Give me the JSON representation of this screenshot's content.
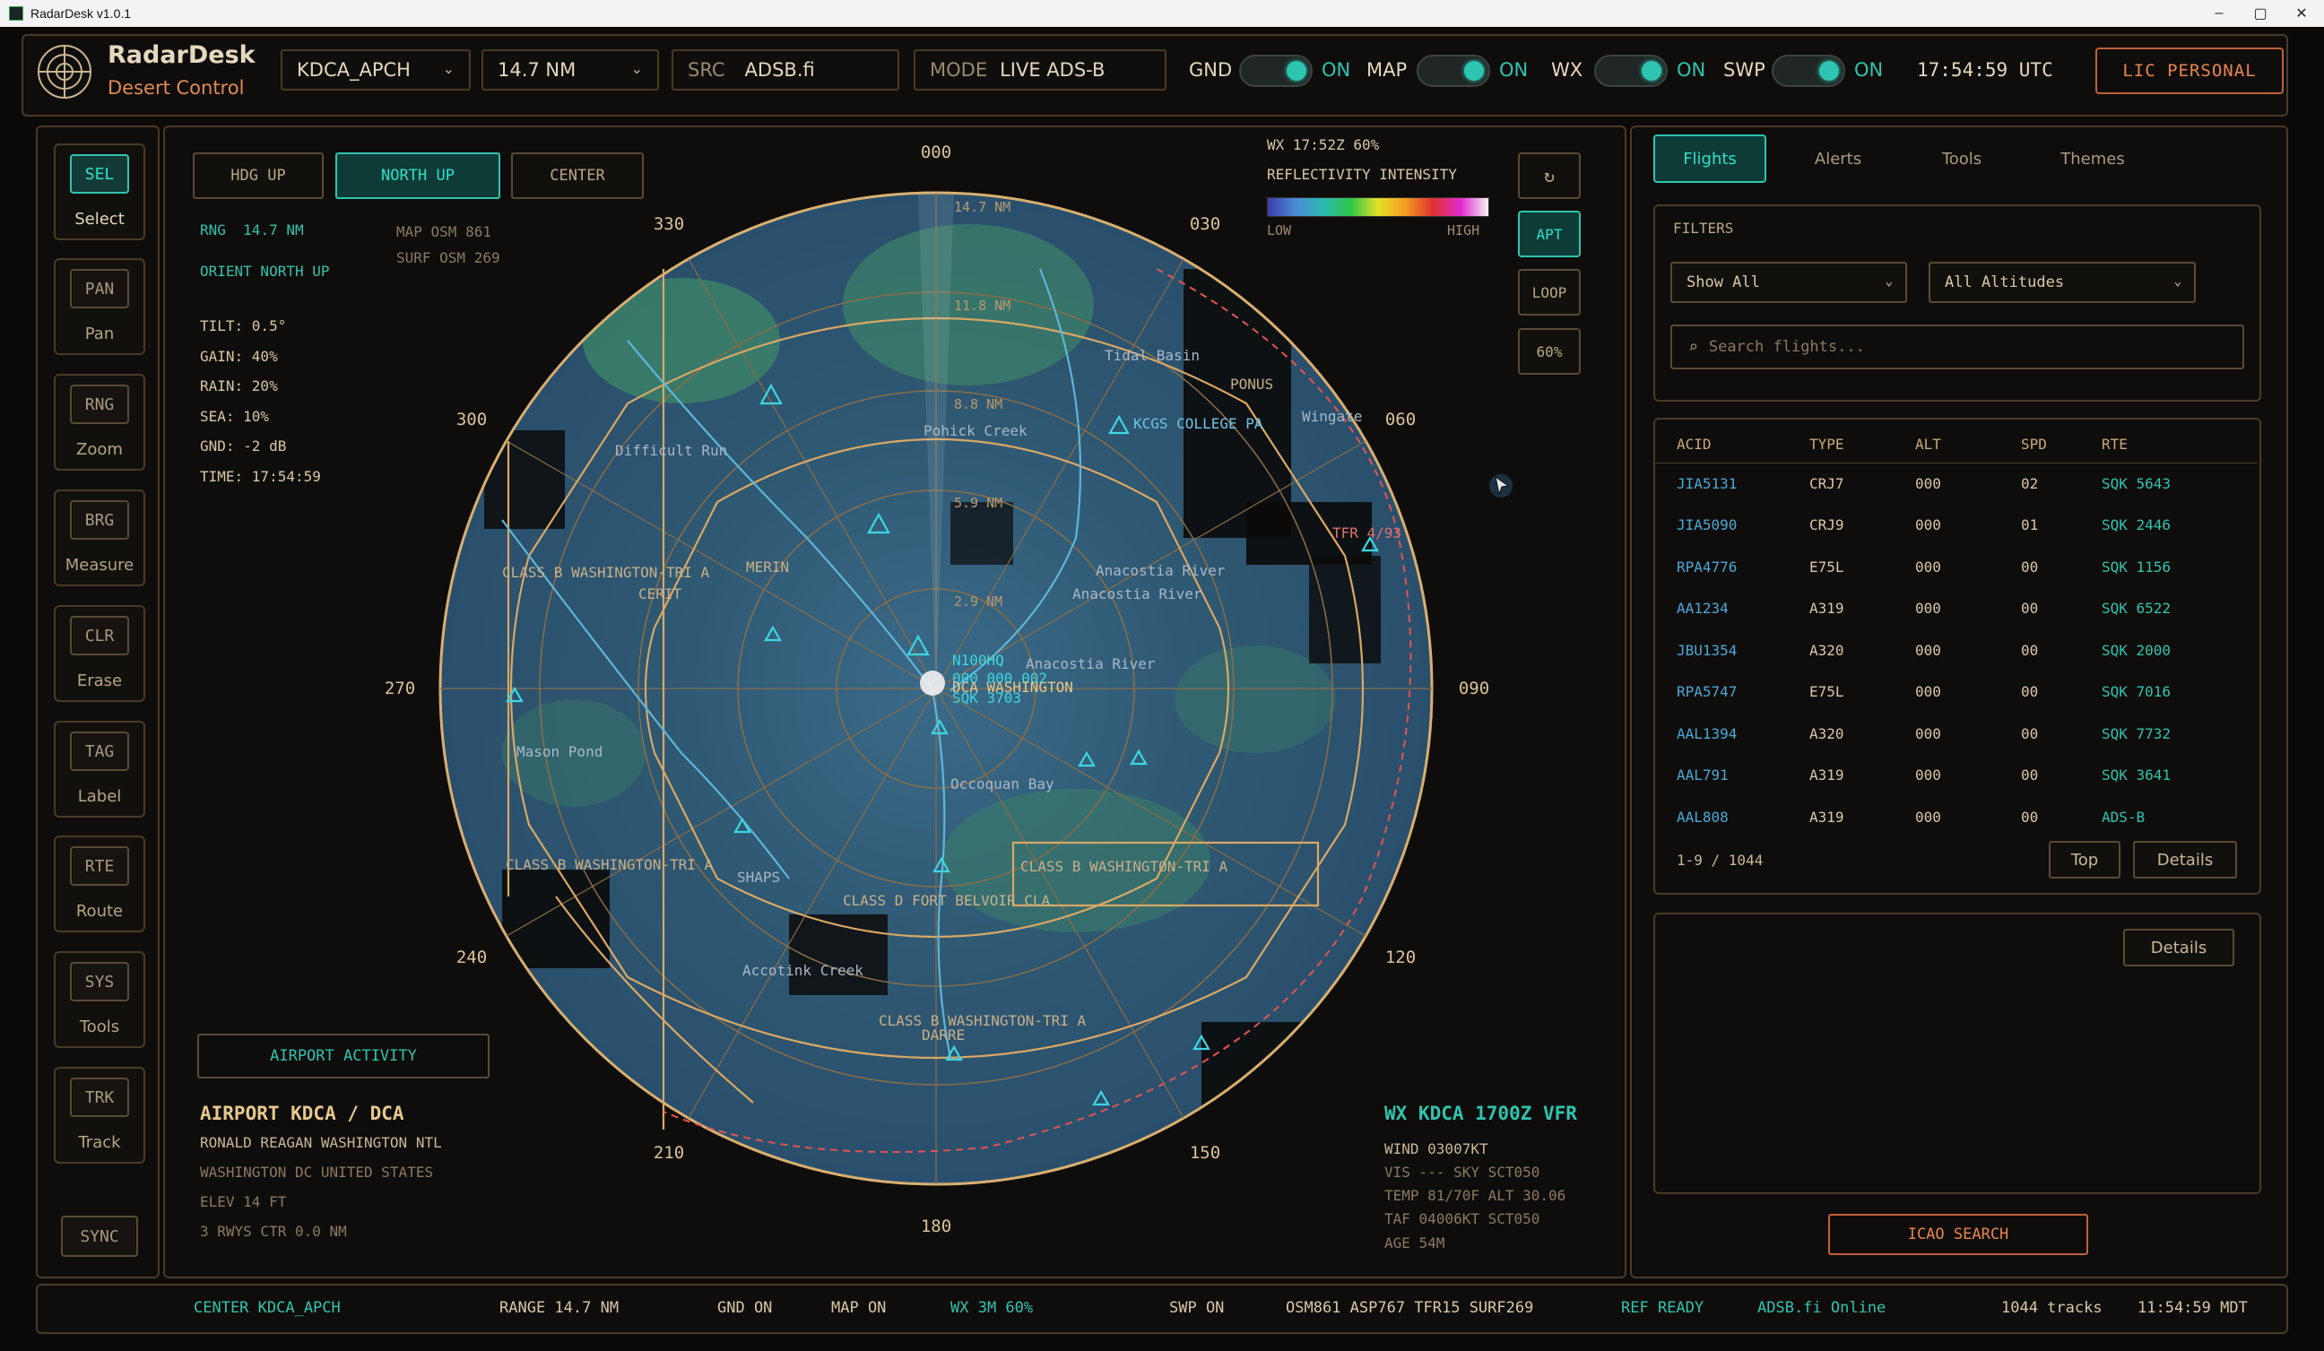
{
  "window": {
    "title": "RadarDesk v1.0.1",
    "min": "–",
    "max": "▢",
    "close": "✕"
  },
  "header": {
    "brand": "RadarDesk",
    "subtitle": "Desert Control",
    "facility": "KDCA_APCH",
    "range": "14.7 NM",
    "src_label": "SRC",
    "src_value": "ADSB.fi",
    "mode_label": "MODE",
    "mode_value": "LIVE ADS-B",
    "toggles": [
      {
        "label": "GND",
        "state": "ON"
      },
      {
        "label": "MAP",
        "state": "ON"
      },
      {
        "label": "WX",
        "state": "ON"
      },
      {
        "label": "SWP",
        "state": "ON"
      }
    ],
    "clock": "17:54:59 UTC",
    "license": "LIC PERSONAL"
  },
  "tools": [
    {
      "code": "SEL",
      "label": "Select",
      "active": true
    },
    {
      "code": "PAN",
      "label": "Pan"
    },
    {
      "code": "RNG",
      "label": "Zoom"
    },
    {
      "code": "BRG",
      "label": "Measure"
    },
    {
      "code": "CLR",
      "label": "Erase"
    },
    {
      "code": "TAG",
      "label": "Label"
    },
    {
      "code": "RTE",
      "label": "Route"
    },
    {
      "code": "SYS",
      "label": "Tools"
    },
    {
      "code": "TRK",
      "label": "Track"
    }
  ],
  "sync": "SYNC",
  "radar": {
    "buttons": {
      "hdg_up": "HDG UP",
      "north_up": "NORTH UP",
      "center": "CENTER"
    },
    "rng_label": "RNG",
    "rng_value": "14.7 NM",
    "orient": "ORIENT NORTH UP",
    "map_osm": "MAP OSM 861",
    "surf_osm": "SURF OSM 269",
    "params": [
      "TILT: 0.5°",
      "GAIN: 40%",
      "RAIN: 20%",
      "SEA: 10%",
      "GND: -2 dB",
      "TIME: 17:54:59"
    ],
    "wx_time": "WX 17:52Z  60%",
    "reflectivity": "REFLECTIVITY INTENSITY",
    "low": "LOW",
    "high": "HIGH",
    "side_buttons": {
      "refresh": "↻",
      "apt": "APT",
      "loop": "LOOP",
      "pct": "60%"
    },
    "bearings": [
      "000",
      "030",
      "060",
      "090",
      "120",
      "150",
      "180",
      "210",
      "240",
      "270",
      "300",
      "330"
    ],
    "rings": [
      "14.7 NM",
      "11.8 NM",
      "8.8 NM",
      "5.9 NM",
      "2.9 NM"
    ],
    "map_labels": [
      "CLASS B WASHINGTON-TRI A",
      "CLASS B WASHINGTON-TRI A",
      "CLASS B WASHINGTON-TRI A",
      "CLASS B WASHINGTON-TRI A",
      "CLASS D FORT BELVOIR CLA",
      "KCGS COLLEGE PA",
      "Anacostia River",
      "Anacostia River",
      "Anacostia River",
      "Mason Pond",
      "Accotink Creek",
      "Occoquan Bay",
      "PONUS",
      "DARRE",
      "CERIT",
      "MERIN",
      "Tidal Basin",
      "TFR 4/93",
      "Wingate",
      "Difficult Run",
      "Pohick Creek",
      "SHAPS"
    ],
    "center_labels": [
      "N100HQ",
      "000 000 002",
      "DCA WASHINGTON",
      "SQK 3703"
    ],
    "airport_activity": "AIRPORT ACTIVITY",
    "airport": {
      "title": "AIRPORT KDCA / DCA",
      "name": "RONALD REAGAN WASHINGTON NTL",
      "location": "WASHINGTON DC UNITED STATES",
      "elev": "ELEV 14 FT",
      "rwys": "3 RWYS  CTR 0.0 NM"
    },
    "wx": {
      "title": "WX KDCA 1700Z VFR",
      "wind": "WIND 03007KT",
      "vis": "VIS ---  SKY SCT050",
      "temp": "TEMP 81/70F  ALT 30.06",
      "taf": "TAF 04006KT SCT050",
      "age": "AGE 54M"
    }
  },
  "sidebar": {
    "tabs": [
      "Flights",
      "Alerts",
      "Tools",
      "Themes"
    ],
    "filters_label": "FILTERS",
    "show_filter": "Show All",
    "alt_filter": "All Altitudes",
    "search_placeholder": "Search flights...",
    "columns": [
      "ACID",
      "TYPE",
      "ALT",
      "SPD",
      "RTE"
    ],
    "flights": [
      {
        "acid": "JIA5131",
        "type": "CRJ7",
        "alt": "000",
        "spd": "02",
        "rte": "SQK 5643"
      },
      {
        "acid": "JIA5090",
        "type": "CRJ9",
        "alt": "000",
        "spd": "01",
        "rte": "SQK 2446"
      },
      {
        "acid": "RPA4776",
        "type": "E75L",
        "alt": "000",
        "spd": "00",
        "rte": "SQK 1156"
      },
      {
        "acid": "AA1234",
        "type": "A319",
        "alt": "000",
        "spd": "00",
        "rte": "SQK 6522"
      },
      {
        "acid": "JBU1354",
        "type": "A320",
        "alt": "000",
        "spd": "00",
        "rte": "SQK 2000"
      },
      {
        "acid": "RPA5747",
        "type": "E75L",
        "alt": "000",
        "spd": "00",
        "rte": "SQK 7016"
      },
      {
        "acid": "AAL1394",
        "type": "A320",
        "alt": "000",
        "spd": "00",
        "rte": "SQK 7732"
      },
      {
        "acid": "AAL791",
        "type": "A319",
        "alt": "000",
        "spd": "00",
        "rte": "SQK 3641"
      },
      {
        "acid": "AAL808",
        "type": "A319",
        "alt": "000",
        "spd": "00",
        "rte": "ADS-B"
      }
    ],
    "pager": "1-9 / 1044",
    "top_btn": "Top",
    "details_btn": "Details",
    "details_btn2": "Details",
    "icao_search": "ICAO SEARCH"
  },
  "statusbar": {
    "center": "CENTER KDCA_APCH",
    "range": "RANGE 14.7 NM",
    "gnd": "GND ON",
    "map": "MAP ON",
    "wx": "WX 3M 60%",
    "swp": "SWP ON",
    "layers": "OSM861 ASP767 TFR15 SURF269",
    "ref": "REF READY",
    "src": "ADSB.fi Online",
    "tracks": "1044 tracks",
    "time": "11:54:59 MDT"
  },
  "colors": {
    "accent": "#2fc4b0",
    "border": "#4a3a26",
    "warn": "#e8864f",
    "route": "#d9a866",
    "tfr": "#e05555"
  }
}
